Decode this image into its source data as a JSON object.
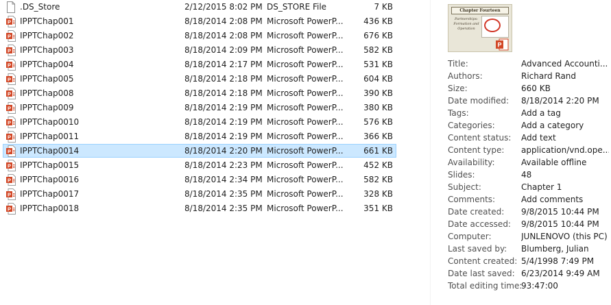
{
  "files": [
    {
      "name": ".DS_Store",
      "date": "2/12/2015 8:02 PM",
      "type": "DS_STORE File",
      "size": "7 KB",
      "icon": "blank-file-icon",
      "selected": false
    },
    {
      "name": "IPPTChap001",
      "date": "8/18/2014 2:08 PM",
      "type": "Microsoft PowerP...",
      "size": "436 KB",
      "icon": "powerpoint-file-icon",
      "selected": false
    },
    {
      "name": "IPPTChap002",
      "date": "8/18/2014 2:08 PM",
      "type": "Microsoft PowerP...",
      "size": "676 KB",
      "icon": "powerpoint-file-icon",
      "selected": false
    },
    {
      "name": "IPPTChap003",
      "date": "8/18/2014 2:09 PM",
      "type": "Microsoft PowerP...",
      "size": "582 KB",
      "icon": "powerpoint-file-icon",
      "selected": false
    },
    {
      "name": "IPPTChap004",
      "date": "8/18/2014 2:17 PM",
      "type": "Microsoft PowerP...",
      "size": "531 KB",
      "icon": "powerpoint-file-icon",
      "selected": false
    },
    {
      "name": "IPPTChap005",
      "date": "8/18/2014 2:18 PM",
      "type": "Microsoft PowerP...",
      "size": "604 KB",
      "icon": "powerpoint-file-icon",
      "selected": false
    },
    {
      "name": "IPPTChap008",
      "date": "8/18/2014 2:18 PM",
      "type": "Microsoft PowerP...",
      "size": "390 KB",
      "icon": "powerpoint-file-icon",
      "selected": false
    },
    {
      "name": "IPPTChap009",
      "date": "8/18/2014 2:19 PM",
      "type": "Microsoft PowerP...",
      "size": "380 KB",
      "icon": "powerpoint-file-icon",
      "selected": false
    },
    {
      "name": "IPPTChap0010",
      "date": "8/18/2014 2:19 PM",
      "type": "Microsoft PowerP...",
      "size": "576 KB",
      "icon": "powerpoint-file-icon",
      "selected": false
    },
    {
      "name": "IPPTChap0011",
      "date": "8/18/2014 2:19 PM",
      "type": "Microsoft PowerP...",
      "size": "366 KB",
      "icon": "powerpoint-file-icon",
      "selected": false
    },
    {
      "name": "IPPTChap0014",
      "date": "8/18/2014 2:20 PM",
      "type": "Microsoft PowerP...",
      "size": "661 KB",
      "icon": "powerpoint-file-icon",
      "selected": true
    },
    {
      "name": "IPPTChap0015",
      "date": "8/18/2014 2:23 PM",
      "type": "Microsoft PowerP...",
      "size": "452 KB",
      "icon": "powerpoint-file-icon",
      "selected": false
    },
    {
      "name": "IPPTChap0016",
      "date": "8/18/2014 2:34 PM",
      "type": "Microsoft PowerP...",
      "size": "582 KB",
      "icon": "powerpoint-file-icon",
      "selected": false
    },
    {
      "name": "IPPTChap0017",
      "date": "8/18/2014 2:35 PM",
      "type": "Microsoft PowerP...",
      "size": "328 KB",
      "icon": "powerpoint-file-icon",
      "selected": false
    },
    {
      "name": "IPPTChap0018",
      "date": "8/18/2014 2:35 PM",
      "type": "Microsoft PowerP...",
      "size": "351 KB",
      "icon": "powerpoint-file-icon",
      "selected": false
    }
  ],
  "details": {
    "thumbnail": {
      "title": "Chapter Fourteen",
      "body": "Partnerships: Formation and Operation"
    },
    "properties": [
      {
        "key": "Title:",
        "value": "Advanced Accounti...",
        "editable": false
      },
      {
        "key": "Authors:",
        "value": "Richard Rand",
        "editable": true
      },
      {
        "key": "Size:",
        "value": "660 KB",
        "editable": false
      },
      {
        "key": "Date modified:",
        "value": "8/18/2014 2:20 PM",
        "editable": false
      },
      {
        "key": "Tags:",
        "value": "Add a tag",
        "editable": true
      },
      {
        "key": "Categories:",
        "value": "Add a category",
        "editable": true
      },
      {
        "key": "Content status:",
        "value": "Add text",
        "editable": true
      },
      {
        "key": "Content type:",
        "value": "application/vnd.ope...",
        "editable": false
      },
      {
        "key": "Availability:",
        "value": "Available offline",
        "editable": false
      },
      {
        "key": "Slides:",
        "value": "48",
        "editable": false
      },
      {
        "key": "Subject:",
        "value": "Chapter 1",
        "editable": true
      },
      {
        "key": "Comments:",
        "value": "Add comments",
        "editable": true
      },
      {
        "key": "Date created:",
        "value": "9/8/2015 10:44 PM",
        "editable": false
      },
      {
        "key": "Date accessed:",
        "value": "9/8/2015 10:44 PM",
        "editable": false
      },
      {
        "key": "Computer:",
        "value": "JUNLENOVO (this PC)",
        "editable": false
      },
      {
        "key": "Last saved by:",
        "value": "Blumberg, Julian",
        "editable": false
      },
      {
        "key": "Content created:",
        "value": "5/4/1998 7:49 PM",
        "editable": false
      },
      {
        "key": "Date last saved:",
        "value": "6/23/2014 9:49 AM",
        "editable": false
      },
      {
        "key": "Total editing time:",
        "value": "93:47:00",
        "editable": false
      }
    ]
  },
  "colors": {
    "selection_bg": "#cce8ff",
    "selection_border": "#99d1ff",
    "powerpoint_red": "#d24726"
  }
}
